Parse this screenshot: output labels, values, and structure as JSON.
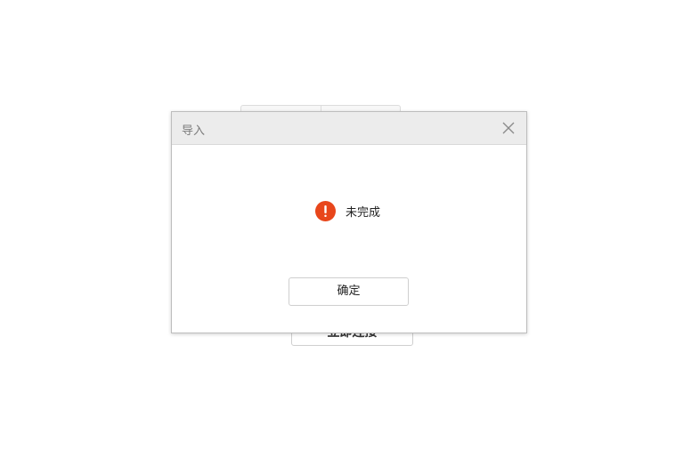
{
  "background": {
    "connect_button_label": "立即连接"
  },
  "dialog": {
    "title": "导入",
    "message": "未完成",
    "ok_label": "确定",
    "alert_icon": "exclamation-circle-icon",
    "alert_color": "#e8461b"
  }
}
